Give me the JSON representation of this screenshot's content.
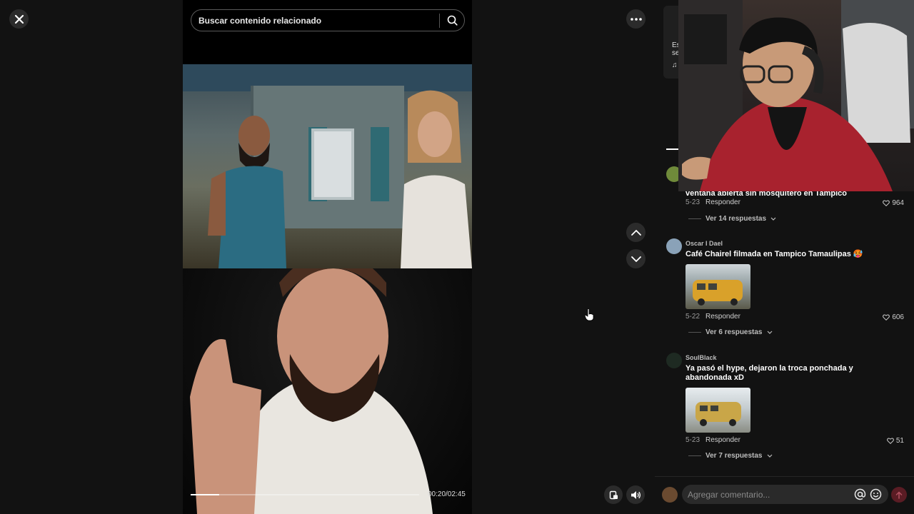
{
  "search": {
    "placeholder": "Buscar contenido relacionado"
  },
  "player": {
    "timecode": "00:20/02:45",
    "progress": 0.125
  },
  "panel": {
    "stub_text": [
      "Es",
      "se",
      "♫"
    ]
  },
  "comments": [
    {
      "user": "",
      "text": "ventana abierta sin mosquitero en Tampico",
      "date": "5-23",
      "reply_label": "Responder",
      "likes": "964",
      "replies_label": "Ver 14 respuestas"
    },
    {
      "user": "Oscar I Dael",
      "text": "Café Chairel filmada en Tampico Tamaulipas 🥵",
      "date": "5-22",
      "reply_label": "Responder",
      "likes": "606",
      "replies_label": "Ver 6 respuestas"
    },
    {
      "user": "SoulBlack",
      "text": "Ya pasó el hype, dejaron la troca ponchada y abandonada xD",
      "date": "5-23",
      "reply_label": "Responder",
      "likes": "51",
      "replies_label": "Ver 7 respuestas"
    }
  ],
  "composer": {
    "placeholder": "Agregar comentario..."
  },
  "colors": {
    "accent": "#fe2c55",
    "panel_bg": "#121212",
    "button_bg": "#2b2b2b"
  }
}
